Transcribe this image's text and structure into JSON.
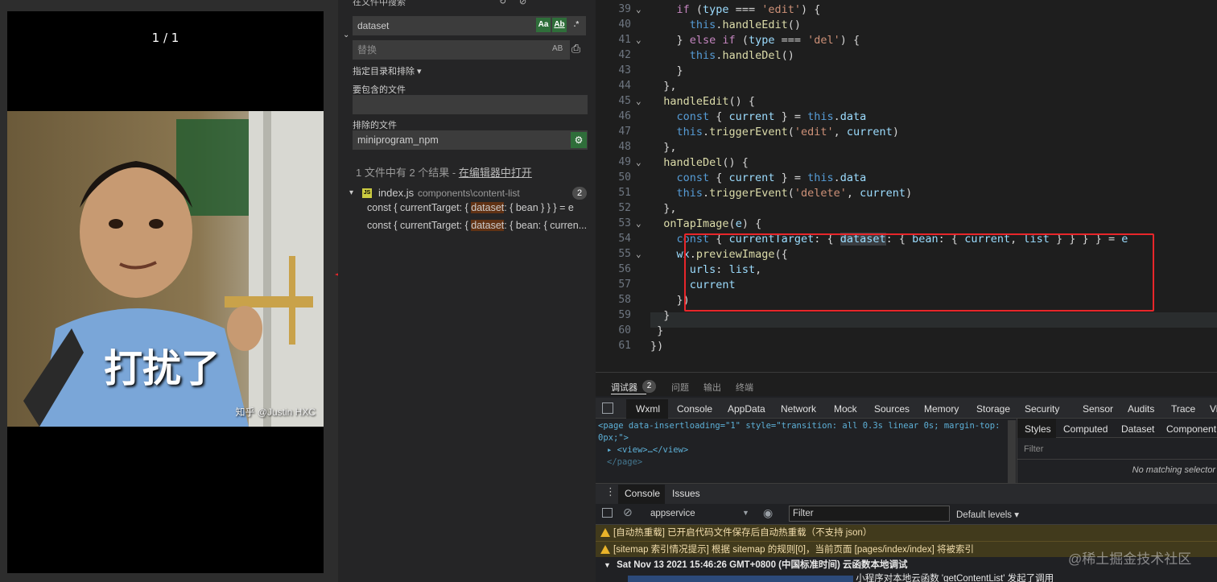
{
  "phone": {
    "pager": "1 / 1",
    "meme_text": "打扰了",
    "watermark": "知乎 @Justin HXC"
  },
  "search": {
    "header": "在文件中搜索",
    "query": "dataset",
    "match_case": "Aa",
    "whole_word": "Ab",
    "regex": ".*",
    "replace_placeholder": "替换",
    "preserve_case": "AB",
    "scope_toggle": "指定目录和排除",
    "include_label": "要包含的文件",
    "include_value": "",
    "exclude_label": "排除的文件",
    "exclude_value": "miniprogram_npm",
    "summary": "1 文件中有 2 个结果 - ",
    "summary_link": "在编辑器中打开",
    "file": {
      "name": "index.js",
      "path": "components\\content-list",
      "count": "2",
      "matches": [
        {
          "pre": "const { currentTarget: { ",
          "hit": "dataset",
          "post": ": { bean } } } = e"
        },
        {
          "pre": "const { currentTarget: { ",
          "hit": "dataset",
          "post": ": { bean: { curren..."
        }
      ]
    }
  },
  "editor": {
    "lines": [
      {
        "n": "39",
        "fold": true,
        "html": "    <span class='kw'>if</span> (<span class='vr'>type</span> === <span class='str'>'edit'</span>) {"
      },
      {
        "n": "40",
        "fold": false,
        "html": "      <span class='kb'>this</span>.<span class='fn'>handleEdit</span>()"
      },
      {
        "n": "41",
        "fold": true,
        "html": "    } <span class='kw'>else if</span> (<span class='vr'>type</span> === <span class='str'>'del'</span>) {"
      },
      {
        "n": "42",
        "fold": false,
        "html": "      <span class='kb'>this</span>.<span class='fn'>handleDel</span>()"
      },
      {
        "n": "43",
        "fold": false,
        "html": "    }"
      },
      {
        "n": "44",
        "fold": false,
        "html": "  },"
      },
      {
        "n": "45",
        "fold": true,
        "html": "  <span class='fn'>handleEdit</span>() {"
      },
      {
        "n": "46",
        "fold": false,
        "html": "    <span class='kb'>const</span> { <span class='vr'>current</span> } = <span class='kb'>this</span>.<span class='vr'>data</span>"
      },
      {
        "n": "47",
        "fold": false,
        "html": "    <span class='kb'>this</span>.<span class='fn'>triggerEvent</span>(<span class='str'>'edit'</span>, <span class='vr'>current</span>)"
      },
      {
        "n": "48",
        "fold": false,
        "html": "  },"
      },
      {
        "n": "49",
        "fold": true,
        "html": "  <span class='fn'>handleDel</span>() {"
      },
      {
        "n": "50",
        "fold": false,
        "html": "    <span class='kb'>const</span> { <span class='vr'>current</span> } = <span class='kb'>this</span>.<span class='vr'>data</span>"
      },
      {
        "n": "51",
        "fold": false,
        "html": "    <span class='kb'>this</span>.<span class='fn'>triggerEvent</span>(<span class='str'>'delete'</span>, <span class='vr'>current</span>)"
      },
      {
        "n": "52",
        "fold": false,
        "html": "  },"
      },
      {
        "n": "53",
        "fold": true,
        "html": "  <span class='fn'>onTapImage</span>(<span class='vr'>e</span>) {"
      },
      {
        "n": "54",
        "fold": false,
        "html": "    <span class='kb'>const</span> { <span class='vr'>currentTarget</span>: { <span class='vr' style='background:#3a3d41'>dataset</span>: { <span class='vr'>bean</span>: { <span class='vr'>current</span>, <span class='vr'>list</span> } } } } = <span class='vr'>e</span>"
      },
      {
        "n": "55",
        "fold": true,
        "html": "    <span class='vr'>wx</span>.<span class='fn'>previewImage</span>({"
      },
      {
        "n": "56",
        "fold": false,
        "html": "      <span class='vr'>urls</span>: <span class='vr'>list</span>,"
      },
      {
        "n": "57",
        "fold": false,
        "html": "      <span class='vr'>current</span>"
      },
      {
        "n": "58",
        "fold": false,
        "html": "    })"
      },
      {
        "n": "59",
        "fold": false,
        "html": "  }"
      },
      {
        "n": "60",
        "fold": false,
        "html": " }"
      },
      {
        "n": "61",
        "fold": false,
        "html": "})"
      }
    ]
  },
  "devtools": {
    "top_tabs": [
      "调试器",
      "问题",
      "输出",
      "终端"
    ],
    "debugger_badge": "2",
    "panel_tabs": [
      "Wxml",
      "Console",
      "AppData",
      "Network",
      "Mock",
      "Sources",
      "Memory",
      "Storage",
      "Security",
      "Sensor",
      "Audits",
      "Trace",
      "Vi"
    ],
    "wxml_line1": "<page data-insertloading=\"1\" style=\"transition: all 0.3s linear 0s; margin-top:",
    "wxml_line1b": "0px;\">",
    "wxml_line2": "<view>…</view>",
    "wxml_line3": "</page>",
    "styles_tabs": [
      "Styles",
      "Computed",
      "Dataset",
      "Component"
    ],
    "filter_placeholder": "Filter",
    "no_match": "No matching selector",
    "console_tabs": [
      "Console",
      "Issues"
    ],
    "context": "appservice",
    "console_filter": "Filter",
    "levels": "Default levels",
    "logs": [
      "[自动热重载] 已开启代码文件保存后自动热重载（不支持 json）",
      "[sitemap 索引情况提示] 根据 sitemap 的规则[0]，当前页面 [pages/index/index] 将被索引"
    ],
    "group_title": "Sat Nov 13 2021 15:46:26 GMT+0800 (中国标准时间) 云函数本地调试",
    "group_last": "小程序对本地云函数 'getContentList' 发起了调用"
  },
  "site_watermark": "@稀土掘金技术社区",
  "colors": {
    "highlight_box": "#e8262a",
    "arrow": "#e8262a",
    "accent": "#0e639c"
  }
}
